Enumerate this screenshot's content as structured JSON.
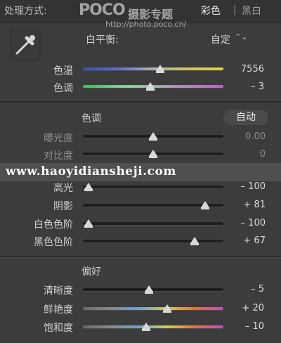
{
  "header": {
    "treatment_label": "处理方式:",
    "color_option": "彩色",
    "divider": "|",
    "bw_option": "黑白"
  },
  "watermark": {
    "logo": "POCO",
    "title": "摄影专题",
    "url": "http://photo.poco.cn/",
    "site": "www.haoyidiansheji.com"
  },
  "white_balance": {
    "label": "白平衡:",
    "value": "自定",
    "arrows": "⌃⌄",
    "temp": {
      "label": "色温",
      "value": "7556",
      "level": 0.55
    },
    "tint": {
      "label": "色调",
      "value": "– 3",
      "level": 0.48
    }
  },
  "tone": {
    "title": "色调",
    "auto_label": "自动",
    "exposure": {
      "label": "曝光度",
      "value": "0.00",
      "level": 0.5
    },
    "contrast": {
      "label": "对比度",
      "value": "0",
      "level": 0.5
    },
    "highlights": {
      "label": "高光",
      "value": "– 100",
      "level": 0.0
    },
    "shadows": {
      "label": "阴影",
      "value": "+ 81",
      "level": 0.9
    },
    "whites": {
      "label": "白色色阶",
      "value": "– 100",
      "level": 0.0
    },
    "blacks": {
      "label": "黑色色阶",
      "value": "+ 67",
      "level": 0.82
    }
  },
  "presence": {
    "title": "偏好",
    "clarity": {
      "label": "清晰度",
      "value": "– 5",
      "level": 0.47
    },
    "vibrance": {
      "label": "鲜艳度",
      "value": "+ 20",
      "level": 0.6
    },
    "saturation": {
      "label": "饱和度",
      "value": "– 10",
      "level": 0.45
    }
  },
  "colors": {
    "panel_bg": "#3c3c3c",
    "track": "#1e1e1e",
    "thumb": "#d8d8d8"
  }
}
